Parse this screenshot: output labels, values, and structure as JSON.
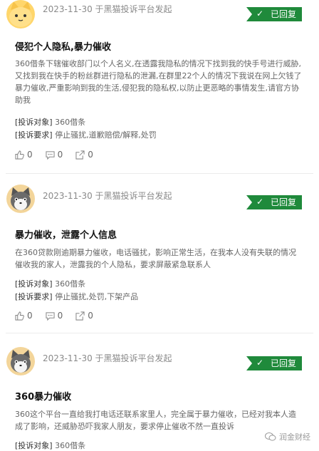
{
  "complaints": [
    {
      "meta": "2023-11-30 于黑猫投诉平台发起",
      "status": "已回复",
      "title": "侵犯个人隐私,暴力催收",
      "body": "360借条下辖催收部门以个人名义,在透露我隐私的情况下找到我的快手号进行威胁,又找到我在快手的粉丝群进行隐私的泄漏,在群里22个人的情况下我说在网上欠钱了暴力催收,严重影响到我的生活,侵犯我的隐私权,以防止更恶略的事情发生,请官方协助我",
      "target_label": "[投诉对象]",
      "target": "360借条",
      "request_label": "[投诉要求]",
      "request": "停止骚扰,道歉赔偿/解释,处罚",
      "likes": "0",
      "comments": "0",
      "shares": "0"
    },
    {
      "meta": "2023-11-30 于黑猫投诉平台发起",
      "status": "已回复",
      "title": "暴力催收，泄露个人信息",
      "body": "在360贷款刚逾期暴力催收，电话骚扰，影响正常生活，在我本人没有失联的情况催收我的家人，泄露我的个人隐私，要求屏蔽紧急联系人",
      "target_label": "[投诉对象]",
      "target": "360借条",
      "request_label": "[投诉要求]",
      "request": "停止骚扰,处罚,下架产品",
      "likes": "0",
      "comments": "0",
      "shares": "0"
    },
    {
      "meta": "2023-11-30 于黑猫投诉平台发起",
      "status": "已回复",
      "title": "360暴力催收",
      "body": "360这个平台一直给我打电话还联系家里人，完全属于暴力催收，已经对我本人造成了影响，还威胁恐吓我家人朋友，要求停止催收不然一直投诉",
      "target_label": "[投诉对象]",
      "target": "360借条"
    }
  ],
  "watermark": "润金财经",
  "icons": {
    "avatar_1": "yellow-cat-avatar-icon",
    "avatar_2": "gray-cat-avatar-icon",
    "like": "thumbs-up-icon",
    "comment": "comment-icon",
    "share": "share-icon",
    "check": "check-icon"
  },
  "colors": {
    "badge": "#1f8a3b",
    "text_primary": "#111111",
    "text_secondary": "#666666",
    "meta": "#8a8a8a"
  }
}
